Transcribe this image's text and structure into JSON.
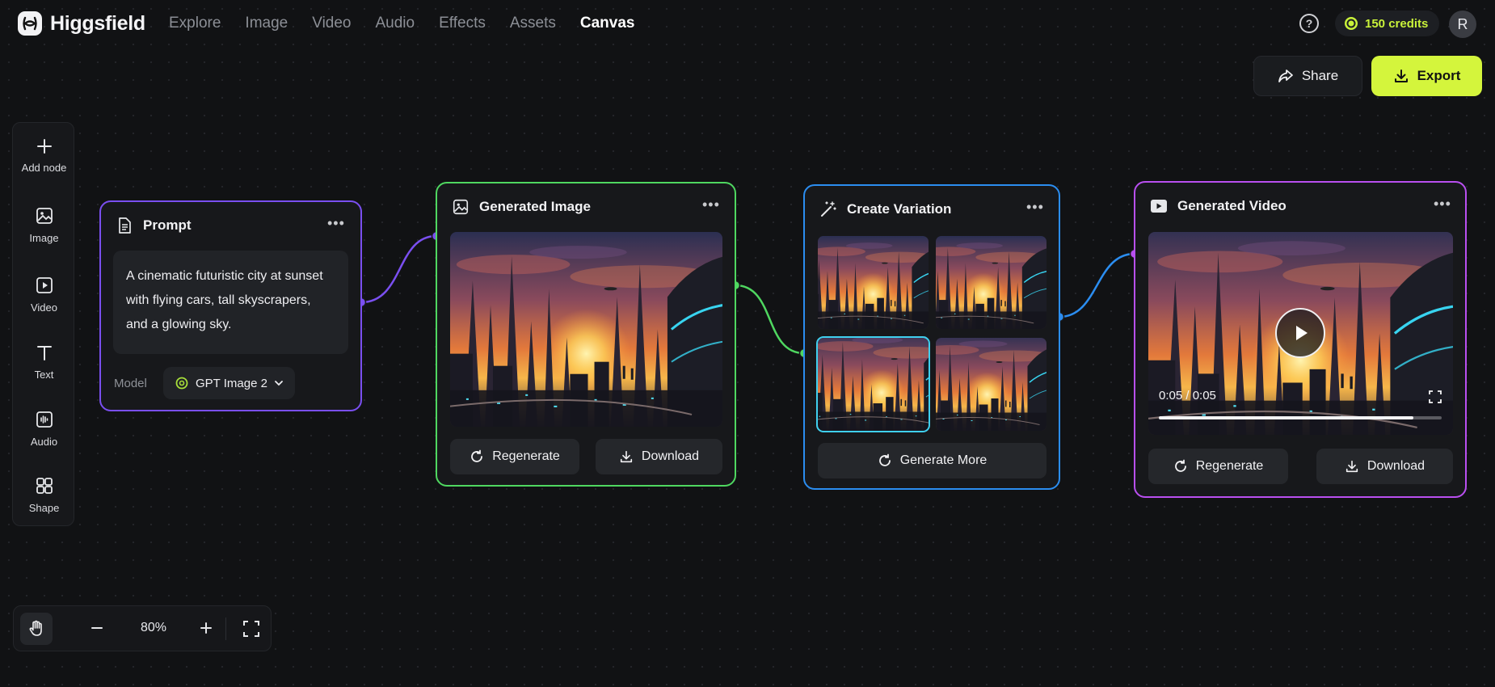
{
  "app": {
    "name": "Higgsfield"
  },
  "nav": [
    {
      "label": "Explore",
      "active": false
    },
    {
      "label": "Image",
      "active": false
    },
    {
      "label": "Video",
      "active": false
    },
    {
      "label": "Audio",
      "active": false
    },
    {
      "label": "Effects",
      "active": false
    },
    {
      "label": "Assets",
      "active": false
    },
    {
      "label": "Canvas",
      "active": true
    }
  ],
  "header": {
    "help_glyph": "?",
    "credits": "150 credits",
    "avatar_initial": "R",
    "share_label": "Share",
    "export_label": "Export"
  },
  "toolbar": {
    "items": [
      {
        "label": "Add node",
        "icon": "plus-icon"
      },
      {
        "label": "Image",
        "icon": "image-icon"
      },
      {
        "label": "Video",
        "icon": "video-icon"
      },
      {
        "label": "Text",
        "icon": "text-icon"
      },
      {
        "label": "Audio",
        "icon": "audio-icon"
      },
      {
        "label": "Shape",
        "icon": "shape-icon"
      }
    ]
  },
  "zoom": {
    "value": "80%"
  },
  "nodes": {
    "prompt": {
      "title": "Prompt",
      "text": "A cinematic futuristic city at sunset with flying cars, tall skyscrapers, and a glowing sky.",
      "model_label": "Model",
      "model_value": "GPT Image 2"
    },
    "generated_image": {
      "title": "Generated Image",
      "regenerate_label": "Regenerate",
      "download_label": "Download"
    },
    "create_variation": {
      "title": "Create Variation",
      "generate_more_label": "Generate More",
      "selected_index": 2
    },
    "generated_video": {
      "title": "Generated Video",
      "time": "0:05 / 0:05",
      "progress": 0.9,
      "regenerate_label": "Regenerate",
      "download_label": "Download"
    }
  },
  "colors": {
    "accent": "#d4f53c",
    "prompt_border": "#7a4ff0",
    "image_border": "#4fd760",
    "variation_border": "#2b8df0",
    "video_border": "#b94ff0"
  }
}
